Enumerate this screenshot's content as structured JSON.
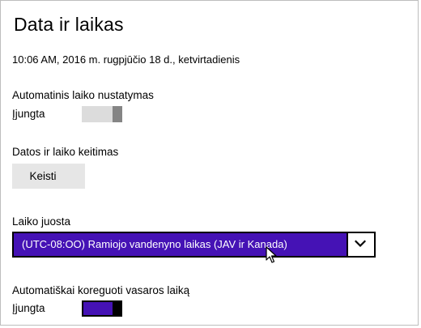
{
  "window": {
    "title": "Data ir laikas"
  },
  "datetime": {
    "current": "10:06 AM, 2016 m. rugpjūčio 18 d., ketvirtadienis"
  },
  "auto_time": {
    "label": "Automatinis laiko nustatymas",
    "state_label": "Įjungta",
    "enabled": false
  },
  "change_datetime": {
    "label": "Datos ir laiko keitimas",
    "button_label": "Keisti"
  },
  "timezone": {
    "label": "Laiko juosta",
    "selected": "(UTC-08:OO) Ramiojo vandenyno laikas (JAV ir Kanada)",
    "chevron_icon": "chevron-down-icon"
  },
  "dst": {
    "label": "Automatiškai koreguoti vasaros laiką",
    "state_label": "Įjungta",
    "enabled": true
  },
  "colors": {
    "accent": "#4512b5",
    "toggle_off_track": "#dcdcdc",
    "toggle_off_thumb": "#858585",
    "button_bg": "#e6e6e6"
  }
}
